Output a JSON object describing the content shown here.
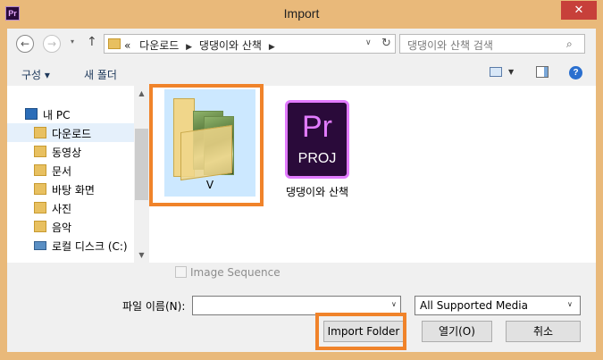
{
  "window": {
    "app_icon_text": "Pr",
    "title": "Import",
    "close_glyph": "✕"
  },
  "nav": {
    "back_glyph": "←",
    "forward_glyph": "→",
    "dropdown_glyph": "▾",
    "up_glyph": "↑",
    "address": {
      "prefix": "«",
      "crumbs": [
        "다운로드",
        "댕댕이와 산책"
      ],
      "separator": "▶",
      "dropdown_glyph": "∨",
      "refresh_glyph": "↻"
    },
    "search": {
      "placeholder": "댕댕이와 산책 검색",
      "icon_glyph": "⌕"
    }
  },
  "toolbar": {
    "organize_label": "구성 ▾",
    "new_folder_label": "새 폴더",
    "view_dropdown_glyph": "▼",
    "help_glyph": "?"
  },
  "sidebar": {
    "items": [
      {
        "label": "내 PC",
        "icon": "computer-icon"
      },
      {
        "label": "다운로드",
        "icon": "downloads-folder-icon"
      },
      {
        "label": "동영상",
        "icon": "videos-folder-icon"
      },
      {
        "label": "문서",
        "icon": "documents-folder-icon"
      },
      {
        "label": "바탕 화면",
        "icon": "desktop-folder-icon"
      },
      {
        "label": "사진",
        "icon": "pictures-folder-icon"
      },
      {
        "label": "음악",
        "icon": "music-folder-icon"
      },
      {
        "label": "로컬 디스크 (C:)",
        "icon": "drive-icon"
      }
    ],
    "selected_index": 1,
    "scroll_up_glyph": "▲",
    "scroll_down_glyph": "▼"
  },
  "files": [
    {
      "name": "V",
      "type": "folder",
      "icon": "folder-with-photos-icon"
    },
    {
      "name": "댕댕이와 산책",
      "type": "premiere-project",
      "icon_main": "Pr",
      "icon_ext": "PROJ"
    }
  ],
  "bottom": {
    "image_sequence_label": "Image Sequence",
    "file_name_label": "파일 이름(N):",
    "file_name_value": "",
    "file_name_dropdown_glyph": "∨",
    "file_type_value": "All Supported Media",
    "file_type_dropdown_glyph": "∨",
    "import_folder_label": "Import Folder",
    "open_label": "열기(O)",
    "cancel_label": "취소"
  },
  "colors": {
    "title_bar": "#e9b97a",
    "close_button": "#c7403a",
    "highlight_outline": "#f0832a",
    "selection": "#cce8ff",
    "premiere_purple": "#e27bff"
  }
}
